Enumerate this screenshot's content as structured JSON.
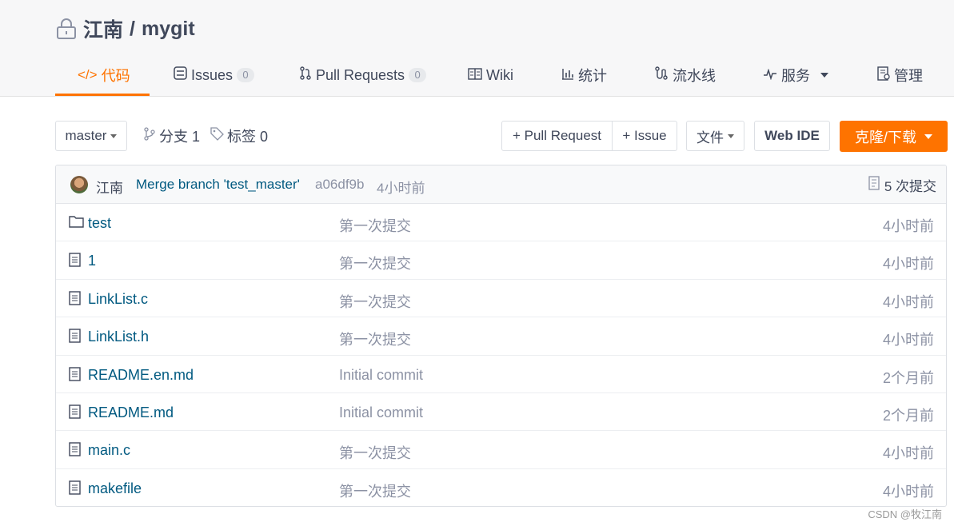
{
  "repo": {
    "owner": "江南",
    "separator": "/",
    "name": "mygit"
  },
  "tabs": [
    {
      "label": "代码",
      "icon": "code-icon"
    },
    {
      "label": "Issues",
      "icon": "issues-icon",
      "count": "0"
    },
    {
      "label": "Pull Requests",
      "icon": "pull-request-icon",
      "count": "0"
    },
    {
      "label": "Wiki",
      "icon": "wiki-icon"
    },
    {
      "label": "统计",
      "icon": "stats-icon"
    },
    {
      "label": "流水线",
      "icon": "pipeline-icon"
    },
    {
      "label": "服务",
      "icon": "pulse-icon"
    },
    {
      "label": "管理",
      "icon": "manage-icon"
    }
  ],
  "toolbar": {
    "branch": "master",
    "branches_label": "分支 1",
    "tags_label": "标签 0",
    "pull_request": "+ Pull Request",
    "issue": "+ Issue",
    "file_menu": "文件",
    "web_ide": "Web IDE",
    "clone": "克隆/下载"
  },
  "commit": {
    "author": "江南",
    "message": "Merge branch 'test_master'",
    "hash": "a06df9b",
    "time": "4小时前",
    "count_label": "5 次提交"
  },
  "files": [
    {
      "name": "test",
      "type": "folder",
      "message": "第一次提交",
      "time": "4小时前"
    },
    {
      "name": "1",
      "type": "file",
      "message": "第一次提交",
      "time": "4小时前"
    },
    {
      "name": "LinkList.c",
      "type": "file",
      "message": "第一次提交",
      "time": "4小时前"
    },
    {
      "name": "LinkList.h",
      "type": "file",
      "message": "第一次提交",
      "time": "4小时前"
    },
    {
      "name": "README.en.md",
      "type": "file",
      "message": "Initial commit",
      "time": "2个月前"
    },
    {
      "name": "README.md",
      "type": "file",
      "message": "Initial commit",
      "time": "2个月前"
    },
    {
      "name": "main.c",
      "type": "file",
      "message": "第一次提交",
      "time": "4小时前"
    },
    {
      "name": "makefile",
      "type": "file",
      "message": "第一次提交",
      "time": "4小时前"
    }
  ],
  "watermark": "CSDN @牧江南",
  "colors": {
    "accent": "#fe7300",
    "link": "#005980",
    "muted": "#8c92a4",
    "text": "#40485b"
  }
}
